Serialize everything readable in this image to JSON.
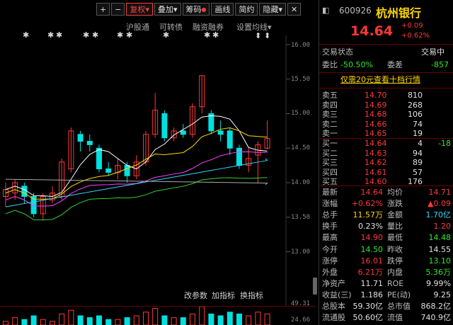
{
  "toolbar": {
    "zoom_in": "+",
    "zoom_out": "−",
    "restore_rights": "复权",
    "overlay": "叠加",
    "chips": "筹码",
    "draw_line": "画线",
    "simple": "简约",
    "hide": "隐藏"
  },
  "indicator_tags": [
    "沪股通",
    "可转债",
    "融资融券",
    "设置均线"
  ],
  "y_axis": [
    "16.00",
    "15.50",
    "15.00",
    "14.50",
    "14.00",
    "13.50",
    "13.00"
  ],
  "sub_panel": {
    "buttons": [
      "改参数",
      "加指标",
      "换指标"
    ],
    "y_labels": [
      "49.31",
      "24.66"
    ]
  },
  "quote": {
    "code": "600926",
    "name": "杭州银行",
    "price": "14.64",
    "change": "+0.09",
    "change_pct": "+0.62%",
    "status_label": "交易状态",
    "status_value": "交易中",
    "weibi_label": "委比",
    "weibi_value": "-50.50%",
    "weicha_label": "委差",
    "weicha_value": "-857",
    "promo": "仅需20元查看十档行情"
  },
  "order_book": {
    "asks": [
      {
        "label": "卖五",
        "price": "14.70",
        "vol": "810"
      },
      {
        "label": "卖四",
        "price": "14.69",
        "vol": "268"
      },
      {
        "label": "卖三",
        "price": "14.68",
        "vol": "106"
      },
      {
        "label": "卖二",
        "price": "14.66",
        "vol": "74"
      },
      {
        "label": "卖一",
        "price": "14.65",
        "vol": "19"
      }
    ],
    "bids": [
      {
        "label": "买一",
        "price": "14.64",
        "vol": "4",
        "chg": "-18"
      },
      {
        "label": "买二",
        "price": "14.63",
        "vol": "94",
        "chg": ""
      },
      {
        "label": "买三",
        "price": "14.62",
        "vol": "89",
        "chg": ""
      },
      {
        "label": "买四",
        "price": "14.61",
        "vol": "57",
        "chg": ""
      },
      {
        "label": "买五",
        "price": "14.60",
        "vol": "176",
        "chg": ""
      }
    ]
  },
  "stats": [
    {
      "l1": "最新",
      "v1": "14.64",
      "c1": "red",
      "l2": "均价",
      "v2": "14.71",
      "c2": "red"
    },
    {
      "l1": "涨幅",
      "v1": "+0.62%",
      "c1": "red",
      "l2": "涨跌",
      "v2": "▲0.09",
      "c2": "red"
    },
    {
      "l1": "总手",
      "v1": "11.57万",
      "c1": "yellow",
      "l2": "金额",
      "v2": "1.70亿",
      "c2": "cyan"
    },
    {
      "l1": "换手",
      "v1": "0.23%",
      "c1": "white",
      "l2": "量比",
      "v2": "1.20",
      "c2": "red"
    },
    {
      "l1": "最高",
      "v1": "14.90",
      "c1": "red",
      "l2": "最低",
      "v2": "14.48",
      "c2": "green"
    },
    {
      "l1": "今开",
      "v1": "14.50",
      "c1": "green",
      "l2": "昨收",
      "v2": "14.55",
      "c2": "white"
    },
    {
      "l1": "涨停",
      "v1": "16.01",
      "c1": "red",
      "l2": "跌停",
      "v2": "13.10",
      "c2": "green"
    },
    {
      "l1": "外盘",
      "v1": "6.21万",
      "c1": "red",
      "l2": "内盘",
      "v2": "5.36万",
      "c2": "green"
    },
    {
      "l1": "净资产",
      "v1": "11.71",
      "c1": "white",
      "l2": "ROE",
      "v2": "9.99%",
      "c2": "white"
    },
    {
      "l1": "收益(三)",
      "v1": "1.186",
      "c1": "white",
      "l2": "PE(动)",
      "v2": "9.25",
      "c2": "white"
    },
    {
      "l1": "总股本",
      "v1": "59.30亿",
      "c1": "white",
      "l2": "总市值",
      "v2": "868.2亿",
      "c2": "white"
    },
    {
      "l1": "流通股",
      "v1": "50.60亿",
      "c1": "white",
      "l2": "流值",
      "v2": "740.9亿",
      "c2": "white"
    }
  ],
  "colors": {
    "up": "#ff3838",
    "down": "#00e0e0",
    "ma5": "#ffffff",
    "ma10": "#ffd700",
    "ma20": "#ff40ff",
    "ma30": "#30d030",
    "ma60": "#30d8ff",
    "ma120": "#aaaaaa"
  },
  "candles": [
    {
      "o": 13.8,
      "c": 13.9,
      "h": 14.0,
      "l": 13.65
    },
    {
      "o": 13.85,
      "c": 14.0,
      "h": 14.05,
      "l": 13.75
    },
    {
      "o": 13.95,
      "c": 13.8,
      "h": 14.0,
      "l": 13.7
    },
    {
      "o": 13.8,
      "c": 13.55,
      "h": 13.85,
      "l": 13.5
    },
    {
      "o": 13.55,
      "c": 13.8,
      "h": 13.85,
      "l": 13.45
    },
    {
      "o": 13.75,
      "c": 13.85,
      "h": 13.95,
      "l": 13.7
    },
    {
      "o": 13.8,
      "c": 14.3,
      "h": 14.35,
      "l": 13.75
    },
    {
      "o": 14.2,
      "c": 14.75,
      "h": 14.8,
      "l": 14.15
    },
    {
      "o": 14.7,
      "c": 14.6,
      "h": 14.75,
      "l": 14.45
    },
    {
      "o": 14.6,
      "c": 14.55,
      "h": 14.7,
      "l": 14.45
    },
    {
      "o": 14.5,
      "c": 14.2,
      "h": 14.55,
      "l": 14.15
    },
    {
      "o": 14.2,
      "c": 14.15,
      "h": 14.3,
      "l": 14.1
    },
    {
      "o": 14.15,
      "c": 14.25,
      "h": 14.35,
      "l": 14.05
    },
    {
      "o": 14.25,
      "c": 14.1,
      "h": 14.3,
      "l": 14.0
    },
    {
      "o": 14.1,
      "c": 14.3,
      "h": 14.4,
      "l": 14.05
    },
    {
      "o": 14.3,
      "c": 14.7,
      "h": 14.75,
      "l": 14.25
    },
    {
      "o": 14.7,
      "c": 15.05,
      "h": 15.3,
      "l": 14.65
    },
    {
      "o": 15.0,
      "c": 14.65,
      "h": 15.05,
      "l": 14.6
    },
    {
      "o": 14.65,
      "c": 14.75,
      "h": 14.8,
      "l": 14.6
    },
    {
      "o": 14.75,
      "c": 14.7,
      "h": 14.85,
      "l": 14.65
    },
    {
      "o": 14.7,
      "c": 15.1,
      "h": 15.15,
      "l": 14.65
    },
    {
      "o": 15.1,
      "c": 15.55,
      "h": 15.55,
      "l": 15.0
    },
    {
      "o": 15.0,
      "c": 14.75,
      "h": 15.05,
      "l": 14.7
    },
    {
      "o": 14.75,
      "c": 14.7,
      "h": 14.9,
      "l": 14.6
    },
    {
      "o": 14.75,
      "c": 14.5,
      "h": 14.8,
      "l": 14.4
    },
    {
      "o": 14.5,
      "c": 14.25,
      "h": 14.55,
      "l": 14.2
    },
    {
      "o": 14.25,
      "c": 14.35,
      "h": 14.5,
      "l": 14.15
    },
    {
      "o": 14.4,
      "c": 14.55,
      "h": 14.6,
      "l": 14.0
    },
    {
      "o": 14.5,
      "c": 14.64,
      "h": 14.9,
      "l": 14.48
    }
  ]
}
